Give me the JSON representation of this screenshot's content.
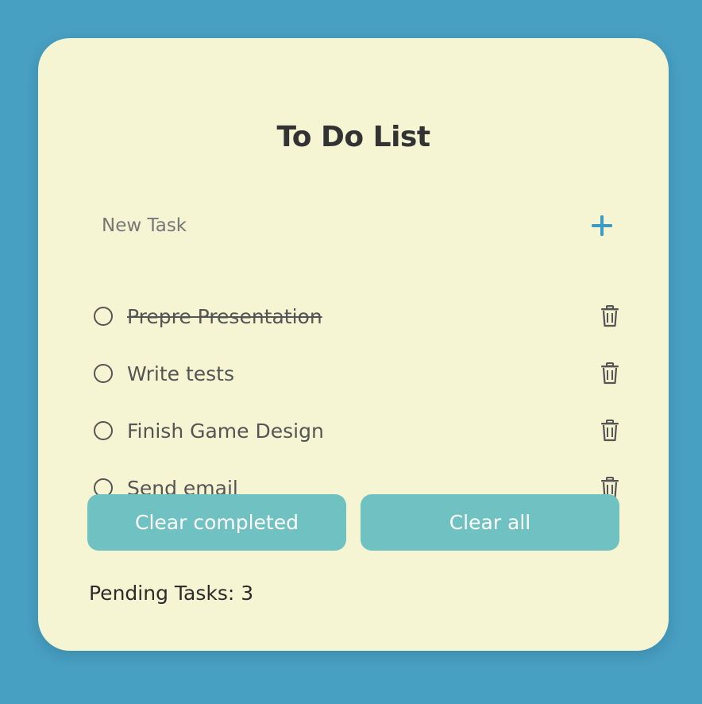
{
  "title": "To Do List",
  "new_task": {
    "placeholder": "New Task",
    "value": ""
  },
  "icons": {
    "add": "plus-icon",
    "delete": "trash-icon",
    "check": "circle-icon"
  },
  "colors": {
    "background": "#479fc2",
    "card": "#f5f5d3",
    "accent": "#3a9cc6",
    "button": "#70c1c1",
    "text": "#555555"
  },
  "tasks": [
    {
      "label": "Prepre Presentation",
      "completed": true
    },
    {
      "label": "Write tests",
      "completed": false
    },
    {
      "label": "Finish Game Design",
      "completed": false
    },
    {
      "label": "Send email",
      "completed": false
    }
  ],
  "buttons": {
    "clear_completed": "Clear completed",
    "clear_all": "Clear all"
  },
  "pending": {
    "label": "Pending Tasks:",
    "count": "3"
  }
}
